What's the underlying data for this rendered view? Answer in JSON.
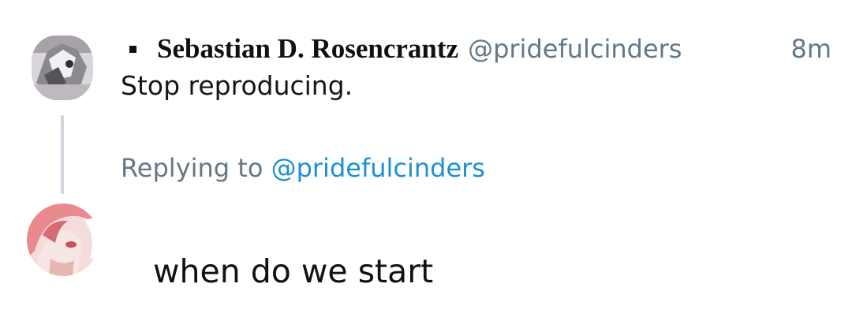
{
  "tweet": {
    "display_name": "Sebastian D. Rosencrantz",
    "handle": "@pridefulcinders",
    "time": "8m",
    "text": "Stop reproducing."
  },
  "reply_context": {
    "label": "Replying to",
    "handle": "@pridefulcinders"
  },
  "reply": {
    "text": "when do we start"
  },
  "colors": {
    "secondary_text": "#657786",
    "link": "#1d8fd2",
    "thread_line": "#cfd6dd"
  }
}
